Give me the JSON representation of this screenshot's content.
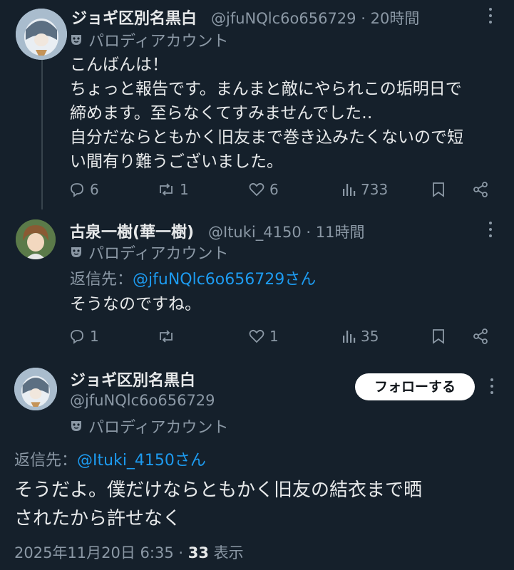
{
  "tweets": [
    {
      "name": "ジョギ区別名黒白",
      "handle": "@jfuNQlc6o656729",
      "sep": "·",
      "time": "20時間",
      "parody_label": "パロディアカウント",
      "body_lines": [
        "こんばんは！",
        "ちょっと報告です。まんまと敵にやられこの垢明日で",
        "締めます。至らなくてすみませんでした‥",
        "自分だならともかく旧友まで巻き込みたくないので短",
        "い間有り難うございました。"
      ],
      "replies": "6",
      "retweets": "1",
      "likes": "6",
      "views": "733"
    },
    {
      "name": "古泉一樹(華一樹)",
      "handle": "@Ituki_4150",
      "sep": "·",
      "time": "11時間",
      "parody_label": "パロディアカウント",
      "reply_prefix": "返信先：",
      "reply_mention": "@jfuNQlc6o656729さん",
      "body": "そうなのですね。",
      "replies": "1",
      "retweets": "",
      "likes": "1",
      "views": "35"
    }
  ],
  "main_tweet": {
    "name": "ジョギ区別名黒白",
    "handle": "@jfuNQlc6o656729",
    "parody_label": "パロディアカウント",
    "follow_label": "フォローする",
    "reply_prefix": "返信先：",
    "reply_mention": "@Ituki_4150さん",
    "body_lines": [
      "そうだよ。僕だけならともかく旧友の結衣まで晒",
      "されたから許せなく"
    ],
    "date": "2025年11月20日 6:35 · ",
    "view_count": "33",
    "view_label": " 表示"
  },
  "colors": {
    "background": "#15202b",
    "text": "#e7e9ea",
    "secondary": "#8b98a5",
    "link": "#1d9bf0",
    "thread_line": "#38444d"
  },
  "icons": [
    "more-icon",
    "parody-mask-icon",
    "reply-icon",
    "retweet-icon",
    "like-icon",
    "views-icon",
    "bookmark-icon",
    "share-icon"
  ]
}
